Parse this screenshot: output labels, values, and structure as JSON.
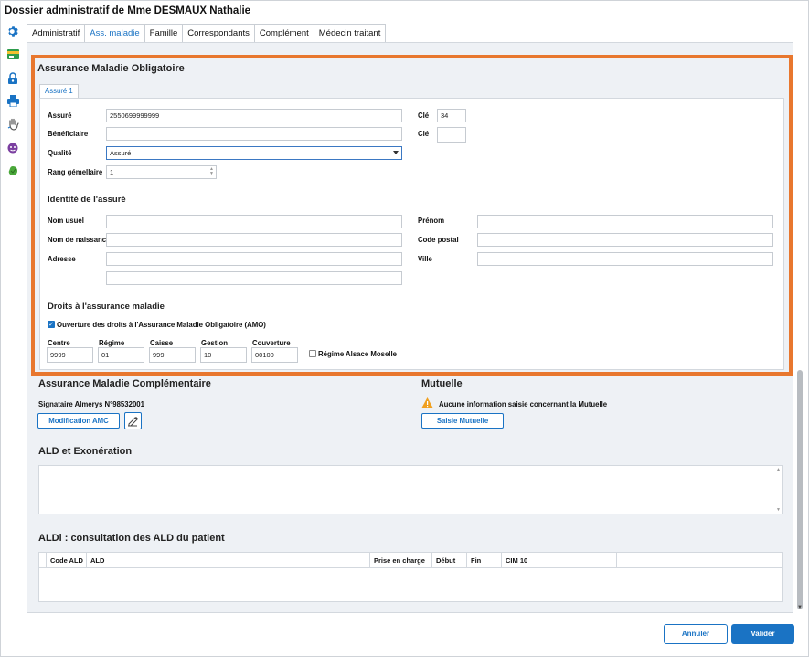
{
  "window": {
    "title": "Dossier administratif de Mme  DESMAUX Nathalie"
  },
  "tabs": [
    "Administratif",
    "Ass. maladie",
    "Famille",
    "Correspondants",
    "Complément",
    "Médecin traitant"
  ],
  "amo": {
    "title": "Assurance Maladie Obligatoire",
    "subtab": "Assuré 1",
    "assure": {
      "label": "Assuré",
      "value": "2550699999999"
    },
    "cle1": {
      "label": "Clé",
      "value": "34"
    },
    "beneficiaire": {
      "label": "Bénéficiaire",
      "value": ""
    },
    "cle2": {
      "label": "Clé",
      "value": ""
    },
    "qualite": {
      "label": "Qualité",
      "value": "Assuré"
    },
    "rang": {
      "label": "Rang gémellaire",
      "value": "1"
    },
    "identite": {
      "title": "Identité de l'assuré",
      "nom_usuel": "Nom usuel",
      "prenom": "Prénom",
      "nom_naissance": "Nom de naissance",
      "code_postal": "Code postal",
      "adresse": "Adresse",
      "ville": "Ville"
    },
    "droits": {
      "title": "Droits à l'assurance maladie",
      "ouverture_label": "Ouverture des droits à l'Assurance Maladie Obligatoire (AMO)",
      "ouverture_checked": true,
      "centre": {
        "label": "Centre",
        "value": "9999"
      },
      "regime": {
        "label": "Régime",
        "value": "01"
      },
      "caisse": {
        "label": "Caisse",
        "value": "999"
      },
      "gestion": {
        "label": "Gestion",
        "value": "10"
      },
      "couverture": {
        "label": "Couverture",
        "value": "00100"
      },
      "alsace_label": "Régime Alsace Moselle",
      "alsace_checked": false
    }
  },
  "amc": {
    "title": "Assurance Maladie Complémentaire",
    "signataire": "Signataire Almerys N°98532001",
    "button": "Modification AMC"
  },
  "mutuelle": {
    "title": "Mutuelle",
    "warning": "Aucune information saisie concernant la Mutuelle",
    "button": "Saisie Mutuelle"
  },
  "ald": {
    "title": "ALD et Exonération"
  },
  "aldi": {
    "title": "ALDi : consultation des ALD du patient",
    "columns": [
      "Code ALD",
      "ALD",
      "Prise en charge",
      "Début",
      "Fin",
      "CIM 10"
    ]
  },
  "footer": {
    "cancel": "Annuler",
    "validate": "Valider"
  },
  "colors": {
    "accent": "#1a73c4",
    "highlight": "#e8772e"
  },
  "sidebar_icons": [
    "settings-icon",
    "card-icon",
    "lock-icon",
    "print-icon",
    "hand-icon",
    "face-icon",
    "green-blob-icon"
  ]
}
